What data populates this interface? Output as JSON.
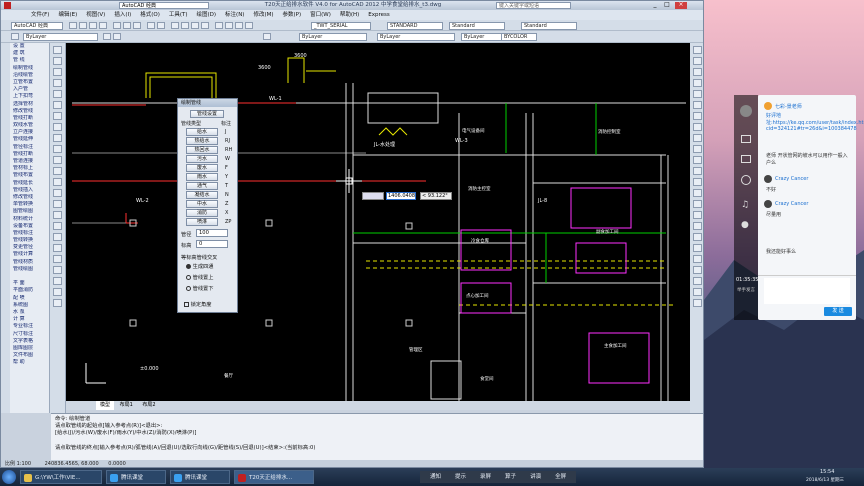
{
  "window": {
    "title": "T20天正给排水软件 V4.0 for AutoCAD 2012   中学食堂给排水_t3.dwg"
  },
  "menu": [
    "文件(F)",
    "编辑(E)",
    "视图(V)",
    "插入(I)",
    "格式(O)",
    "工具(T)",
    "绘图(D)",
    "标注(N)",
    "修改(M)",
    "参数(P)",
    "窗口(W)",
    "帮助(H)",
    "Express"
  ],
  "toolbar": {
    "workspace": "AutoCAD 经典",
    "layer": "_TWT_SERIAL",
    "textstyle": "STANDARD",
    "dimstyle": "Standard",
    "tablestyle": "Standard",
    "color": "ByLayer",
    "linetype": "ByLayer",
    "lineweight": "ByLayer",
    "plotstyle": "BYCOLOR",
    "search": "键入关键字或短语",
    "layerstate": "ByLayer"
  },
  "left_panel": {
    "title": "天正行",
    "items": [
      "设 置",
      "建 筑",
      "管 线",
      "绘制管线",
      "沿线绘管",
      "立管布置",
      "入户管",
      "上下扣弯",
      "选择管材",
      "修改管线",
      "管线打断",
      "双线水管",
      "立户连接",
      "管线延伸",
      "管径标注",
      "管线打断",
      "管道连接",
      "管材标上",
      "管线布置",
      "管线延长",
      "管线插入",
      "修改管线",
      "单管转换",
      "图管绘图",
      "材料统计",
      "设备布置",
      "管线标注",
      "管线转换",
      "变更管径",
      "管线计算",
      "管线材质",
      "管线绘图",
      "",
      "平 面",
      "平面消防",
      "配 喷",
      "系统图",
      "水 泵",
      "计 算",
      "专业标注",
      "尺寸标注",
      "文字表格",
      "图库图层",
      "文件布图",
      "帮 助"
    ]
  },
  "dialog": {
    "title": "绘制管线",
    "buttons": [
      "管线设置",
      "给水",
      "热给水",
      "热回水",
      "污水",
      "废水",
      "雨水",
      "通气",
      "凝结水",
      "中水",
      "消防",
      "喷淋"
    ],
    "keys": [
      "J",
      "RJ",
      "RH",
      "W",
      "F",
      "Y",
      "T",
      "N",
      "Z",
      "X",
      "ZP"
    ],
    "type_label": "管线类型",
    "mark_label": "标注",
    "diameter_label": "管径",
    "diameter_value": "100",
    "elevation_label": "标高",
    "elevation_value": "0",
    "cross_label": "等标高管线交叉",
    "options": [
      "生成四通",
      "管线置上",
      "管线置下"
    ],
    "lock_label": "锁定角度"
  },
  "canvas": {
    "rooms": [
      "电气设备间",
      "消防控制室",
      "消防主控室",
      "粮食加工间",
      "冷食仓库",
      "副食加工间",
      "主食加工间",
      "点心加工间",
      "管理区",
      "餐厅",
      "食堂间",
      "JL-水处理"
    ],
    "dims": [
      "3600",
      "3600"
    ],
    "labels": [
      "WL-2",
      "WL-1",
      "JL-1",
      "WL-3",
      "JL-4",
      "JL-8",
      "WL-1"
    ],
    "tooltip_value": "1406.0408",
    "tooltip_angle": "< 93.122°",
    "elev_mark": "±0.000"
  },
  "tabs": [
    "模型",
    "布局1",
    "布局2"
  ],
  "command": {
    "lines": [
      "命令: 绘制管道",
      "请点取管线的起始点[输入参考点(R)]<退出>:",
      "[给水(J)/污水(W)/废水(F)/雨水(Y)/中水(Z)/消防(X)/喷淋(P)]",
      "请点取管线的终点[输入参考点(R)/弧管线(A)/回退(U)/选取行向线(G)/距管线(S)/回退(U)]<结束>:(当前标高:0)"
    ]
  },
  "status": {
    "scale": "比例 1:100",
    "coords": "240836.4565, 68.000",
    "zoom": "0.0000"
  },
  "chat": {
    "teacher": "七彩-景老师",
    "lines": [
      "好评地址:https://ke.qq.com/user/task/index.html?cid=324121#tr=26d&i=100384478",
      "老师 开状管网的坡水可以用作一般入户么",
      "Crazy Cancer",
      "不好",
      "Crazy Cancer",
      "尽量用",
      "我还能好事么"
    ],
    "timer": "01:35:35",
    "timer_label": "举手发言",
    "send": "发 送"
  },
  "taskbar": {
    "items": [
      "G:\\YW\\工作\\VIE...",
      "腾讯课堂",
      "腾讯课堂",
      "T20天正给排水..."
    ],
    "tray": [
      "通知",
      "提示",
      "录屏",
      "算子",
      "讲演",
      "全屏"
    ],
    "time": "15:54",
    "date": "2018/6/13 星期三"
  },
  "colors": {
    "canvas": "#000000",
    "accent": "#2a4668"
  }
}
